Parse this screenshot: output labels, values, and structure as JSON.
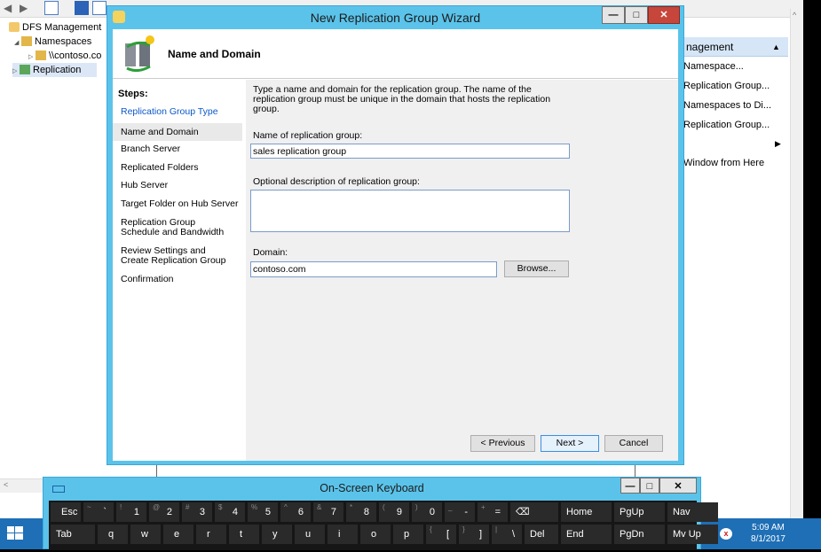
{
  "mmc": {
    "tree": [
      {
        "label": "DFS Management",
        "indent": 0,
        "expander": ""
      },
      {
        "label": "Namespaces",
        "indent": 1,
        "expander": "◢"
      },
      {
        "label": "\\\\contoso.co",
        "indent": 2,
        "expander": "▷"
      },
      {
        "label": "Replication",
        "indent": 1,
        "expander": "▷"
      }
    ],
    "actions_header": "nagement",
    "actions": [
      "Namespace...",
      "Replication Group...",
      "Namespaces to Di...",
      "Replication Group...",
      "Window from Here"
    ]
  },
  "wizard": {
    "title": "New Replication Group Wizard",
    "header_title": "Name and Domain",
    "steps_label": "Steps:",
    "steps": [
      "Replication Group Type",
      "Name and Domain",
      "Branch Server",
      "Replicated Folders",
      "Hub Server",
      "Target Folder on Hub Server",
      "Replication Group Schedule and Bandwidth",
      "Review Settings and Create Replication Group",
      "Confirmation"
    ],
    "description": "Type a name and domain for the replication group. The name of the replication group must be unique in the domain that hosts the replication group.",
    "name_label": "Name of replication group:",
    "name_value": "sales replication group",
    "optional_label": "Optional description of replication group:",
    "optional_value": "",
    "domain_label": "Domain:",
    "domain_value": "contoso.com",
    "browse": "Browse...",
    "previous": "< Previous",
    "next": "Next >",
    "cancel": "Cancel",
    "caption_min": "—",
    "caption_max": "□",
    "caption_close": "✕"
  },
  "osk": {
    "title": "On-Screen Keyboard",
    "row1": [
      {
        "sub": "",
        "main": "Esc"
      },
      {
        "sub": "~",
        "main": "`"
      },
      {
        "sub": "!",
        "main": "1"
      },
      {
        "sub": "@",
        "main": "2"
      },
      {
        "sub": "#",
        "main": "3"
      },
      {
        "sub": "$",
        "main": "4"
      },
      {
        "sub": "%",
        "main": "5"
      },
      {
        "sub": "^",
        "main": "6"
      },
      {
        "sub": "&",
        "main": "7"
      },
      {
        "sub": "*",
        "main": "8"
      },
      {
        "sub": "(",
        "main": "9"
      },
      {
        "sub": ")",
        "main": "0"
      },
      {
        "sub": "_",
        "main": "-"
      },
      {
        "sub": "+",
        "main": "="
      },
      {
        "sub": "",
        "main": "⌫"
      },
      {
        "sub": "",
        "main": "Home"
      },
      {
        "sub": "",
        "main": "PgUp"
      },
      {
        "sub": "",
        "main": "Nav"
      }
    ],
    "row2": [
      {
        "sub": "",
        "main": "Tab"
      },
      {
        "sub": "",
        "main": "q"
      },
      {
        "sub": "",
        "main": "w"
      },
      {
        "sub": "",
        "main": "e"
      },
      {
        "sub": "",
        "main": "r"
      },
      {
        "sub": "",
        "main": "t"
      },
      {
        "sub": "",
        "main": "y"
      },
      {
        "sub": "",
        "main": "u"
      },
      {
        "sub": "",
        "main": "i"
      },
      {
        "sub": "",
        "main": "o"
      },
      {
        "sub": "",
        "main": "p"
      },
      {
        "sub": "{",
        "main": "["
      },
      {
        "sub": "}",
        "main": "]"
      },
      {
        "sub": "|",
        "main": "\\"
      },
      {
        "sub": "",
        "main": "Del"
      },
      {
        "sub": "",
        "main": "End"
      },
      {
        "sub": "",
        "main": "PgDn"
      },
      {
        "sub": "",
        "main": "Mv Up"
      }
    ]
  },
  "taskbar": {
    "time": "5:09 AM",
    "date": "8/1/2017"
  }
}
